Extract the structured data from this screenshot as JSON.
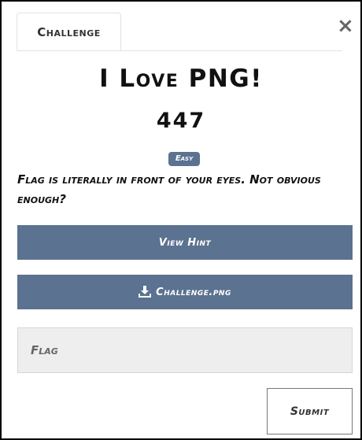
{
  "tabs": [
    {
      "label": "Challenge"
    }
  ],
  "close": {
    "symbol": "×"
  },
  "challenge": {
    "name": "I Love PNG!",
    "points": "447",
    "difficulty": "Easy",
    "description": "Flag is literally in front of your eyes. Not obvious enough?"
  },
  "buttons": {
    "hint_label": "View Hint",
    "file_label": "Challenge.png",
    "file_icon": "download-icon",
    "submit_label": "Submit"
  },
  "flag_input": {
    "placeholder": "Flag",
    "value": ""
  },
  "colors": {
    "primary": "#5b7290",
    "input_bg": "#eeeeee",
    "border": "#000000"
  }
}
